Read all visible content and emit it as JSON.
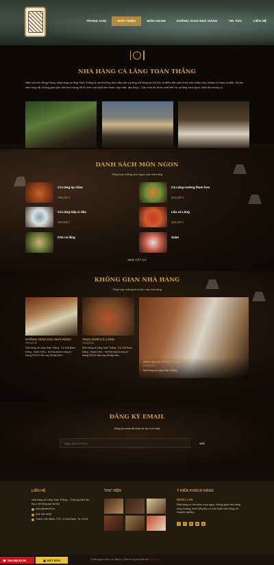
{
  "nav": {
    "items": [
      "TRANG CHỦ",
      "GIỚI THIỆU",
      "MÓN NGON",
      "KHÔNG GIAN NHÀ HÀNG",
      "TIN TỨC",
      "LIÊN HỆ"
    ],
    "active_index": 1
  },
  "intro": {
    "title": "NHÀ HÀNG CÁ LĂNG TOÀN THẮNG",
    "text": "Nằm sát ven Sông Hồng, Nhà hàng cá lăng Toàn Thắng là nơi thưởng thức đặc sản cá lăng nổi tiếng tại Hà Nội, là điểm đến yêu thích của nhiều thực khách từ Nam ra Bắc. Khuôn viên rộng rãi, không gian yên tĩnh thơ mộng để tổ chức các buổi liên hoan, họp mặt, tiệc tùng... Các món ăn được chế biến từ cá lăng tươi ngon, đậm đà hương vị."
  },
  "menu": {
    "title": "DANH SÁCH MÓN NGON",
    "subtitle": "Tổng hợp những món ngon của nhà hàng",
    "dishes": [
      {
        "name": "Cá Lăng áp chảo",
        "price": "300,000 ₫"
      },
      {
        "name": "Cá Lăng nướng tham hoa",
        "price": "300,000 ₫"
      },
      {
        "name": "Cá Lăng hấp xì dầu",
        "price": "300,000 ₫"
      },
      {
        "name": "Lẩu cá Lăng",
        "price": "300,000 ₫"
      },
      {
        "name": "Chả cá lăng",
        "price": ""
      },
      {
        "name": "Salat",
        "price": ""
      }
    ],
    "see_all": "XEM TẤT CẢ"
  },
  "space": {
    "title": "KHÔNG GIAN NHÀ HÀNG",
    "subtitle": "Tổng hợp những hình ảnh của nhà hàng",
    "posts": [
      {
        "title": "KHÔNG GIAN CỦA NHÀ HÀNG",
        "date": "29/03/2018",
        "text": "Nhà hàng cá Lăng Toàn Thắng - Số 445 Bạch Đằng - Hoàn Kiếm - Hà Nội khai trương từ tháng 5/2012 đến nay đã tiếp đón..."
      },
      {
        "title": "THỰC ĐƠN CÁ LĂNG",
        "date": "29/03/2018",
        "text": "Nhà hàng cá Lăng Toàn Thắng - Số 445 Bạch Đằng - Hoàn Kiếm - Hà Nội khai trương từ tháng 5/2012 đến nay đã tiếp đón..."
      },
      {
        "title": "MÓN NGON TỪ CÁ LĂNG",
        "date": "29/03/2018",
        "text": "Nhà hàng cá Lăng Toàn Thắng..."
      }
    ]
  },
  "email": {
    "title": "ĐĂNG KÝ EMAIL",
    "subtitle": "Đăng ký email để nhận tin tức mới nhất",
    "placeholder": "Nhập địa chỉ Email",
    "button": "GỬI"
  },
  "footer": {
    "contact_title": "LIÊN HỆ",
    "contact_text": "Nhà hàng cá Lăng Toàn Thắng – Thương hiệu ẩm thực nổi tiếng tại Hà Nội",
    "email": "hotro@web2s.vn",
    "phone": "094 999 9295",
    "address": "Thanh Văn Bạch, P21, Q.Gia Bạch, Tp. HCM",
    "gallery_title": "THƯ VIỆN",
    "testimonial_title": "Ý KIẾN KHÁCH HÀNG",
    "testimonial_name": "NGỌC LAN",
    "testimonial_text": "Nhà hàng có rất nhiều món ngon, không gian nhà hàng rộng thoáng, thích để phục vụ của nhân viên cũng rất chuyên nghiệp...",
    "socials": [
      "f",
      "t",
      "G",
      "in",
      "y"
    ]
  },
  "bottom": {
    "phone_label": "094.999.92.95",
    "book_label": "ĐẶT BÀN",
    "copyright": "© Bản quyền thuộc về Web2s | Thiết kế và phát triển bởi",
    "copyright_brand": "Web2s.vn"
  },
  "colors": {
    "gold": "#c79a3e",
    "nav_active": "#b08a3e",
    "call_red": "#c8141e",
    "book_yellow": "#e6c13a",
    "background": "#120d08"
  }
}
